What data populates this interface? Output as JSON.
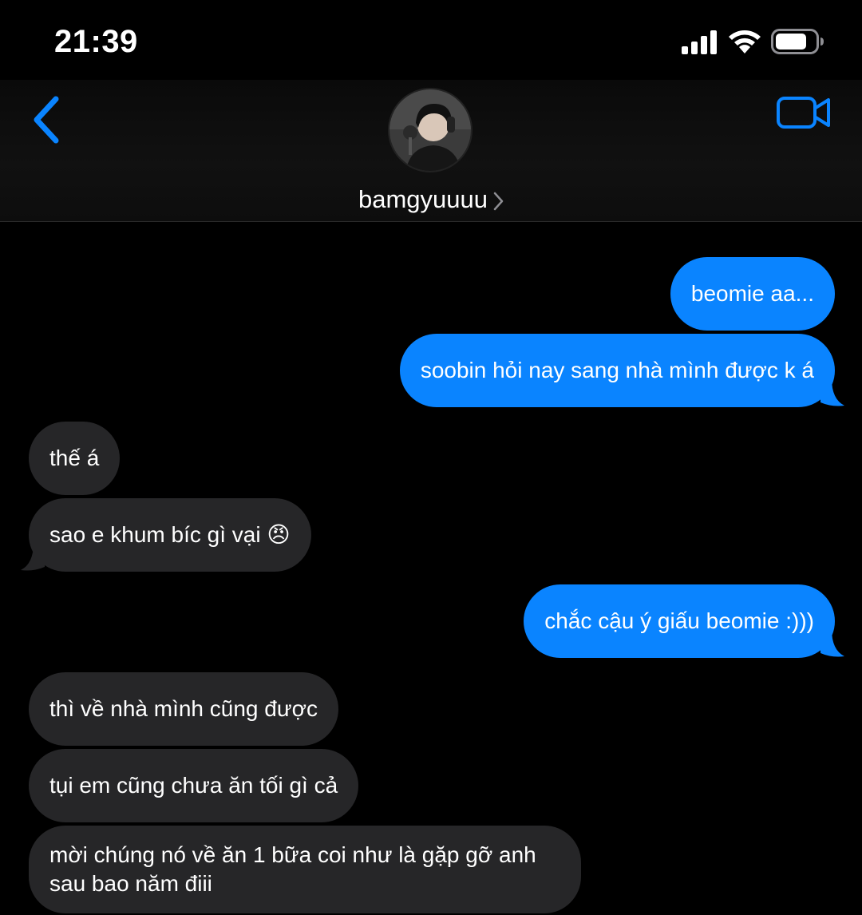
{
  "status_bar": {
    "time": "21:39",
    "signal_icon": "cellular-signal-icon",
    "wifi_icon": "wifi-icon",
    "battery_icon": "battery-icon"
  },
  "header": {
    "back_icon": "chevron-left-icon",
    "video_icon": "video-camera-icon",
    "contact_name": "bamgyuuuu",
    "chevron_icon": "chevron-right-icon",
    "accent_color": "#0a84ff"
  },
  "messages": [
    {
      "side": "sent",
      "text": "beomie aa..."
    },
    {
      "side": "sent",
      "text": "soobin hỏi nay sang nhà mình được k á"
    },
    {
      "side": "received",
      "text": "thế á"
    },
    {
      "side": "received",
      "text": "sao e khum bíc gì vại 😠"
    },
    {
      "side": "sent",
      "text": "chắc cậu ý giấu beomie :)))"
    },
    {
      "side": "received",
      "text": "thì về nhà mình cũng được"
    },
    {
      "side": "received",
      "text": "tụi em cũng chưa ăn tối gì cả"
    },
    {
      "side": "received",
      "text": "mời chúng nó về ăn 1 bữa coi như là gặp gỡ anh sau bao năm điii"
    }
  ],
  "colors": {
    "sent_bubble": "#0a84ff",
    "received_bubble": "#262628",
    "background": "#000000"
  }
}
